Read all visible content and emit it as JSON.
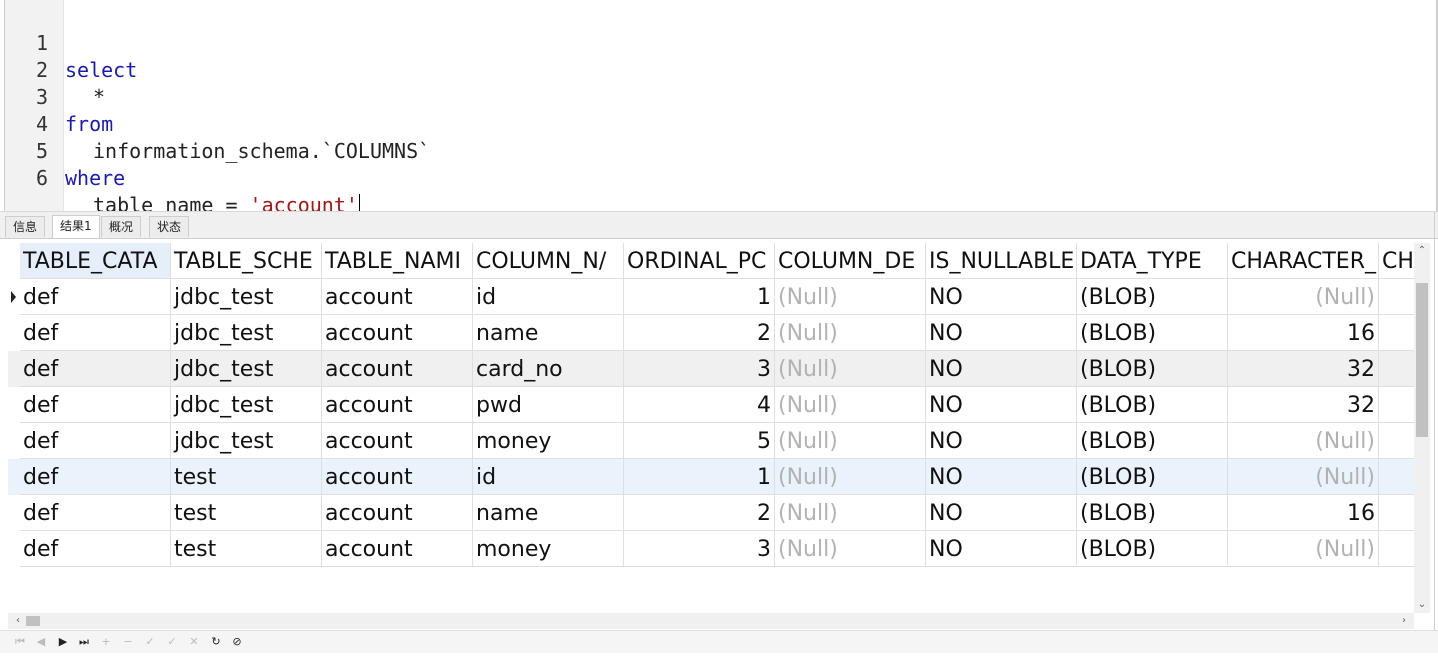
{
  "editor": {
    "lines": [
      {
        "num": "1",
        "text": "select"
      },
      {
        "num": "2",
        "text": "*"
      },
      {
        "num": "3",
        "text": "from"
      },
      {
        "num": "4",
        "text": "information_schema.`COLUMNS`"
      },
      {
        "num": "5",
        "text": "where"
      },
      {
        "num": "6",
        "prefix": "table_name = ",
        "string": "'account'"
      }
    ]
  },
  "tabs": [
    {
      "label": "信息"
    },
    {
      "label": "结果1"
    },
    {
      "label": "概况"
    },
    {
      "label": "状态"
    }
  ],
  "grid": {
    "columns": [
      "TABLE_CATA",
      "TABLE_SCHE",
      "TABLE_NAMI",
      "COLUMN_N/",
      "ORDINAL_PC",
      "COLUMN_DE",
      "IS_NULLABLE",
      "DATA_TYPE",
      "CHARACTER_",
      "CH"
    ],
    "rows": [
      [
        "def",
        "jdbc_test",
        "account",
        "id",
        "1",
        "(Null)",
        "NO",
        "(BLOB)",
        "(Null)"
      ],
      [
        "def",
        "jdbc_test",
        "account",
        "name",
        "2",
        "(Null)",
        "NO",
        "(BLOB)",
        "16"
      ],
      [
        "def",
        "jdbc_test",
        "account",
        "card_no",
        "3",
        "(Null)",
        "NO",
        "(BLOB)",
        "32"
      ],
      [
        "def",
        "jdbc_test",
        "account",
        "pwd",
        "4",
        "(Null)",
        "NO",
        "(BLOB)",
        "32"
      ],
      [
        "def",
        "jdbc_test",
        "account",
        "money",
        "5",
        "(Null)",
        "NO",
        "(BLOB)",
        "(Null)"
      ],
      [
        "def",
        "test",
        "account",
        "id",
        "1",
        "(Null)",
        "NO",
        "(BLOB)",
        "(Null)"
      ],
      [
        "def",
        "test",
        "account",
        "name",
        "2",
        "(Null)",
        "NO",
        "(BLOB)",
        "16"
      ],
      [
        "def",
        "test",
        "account",
        "money",
        "3",
        "(Null)",
        "NO",
        "(BLOB)",
        "(Null)"
      ]
    ]
  },
  "nav": {
    "buttons": [
      {
        "name": "first-record-icon",
        "glyph": "⏮",
        "enabled": false
      },
      {
        "name": "prev-record-icon",
        "glyph": "◀",
        "enabled": false
      },
      {
        "name": "next-record-icon",
        "glyph": "▶",
        "enabled": true
      },
      {
        "name": "last-record-icon",
        "glyph": "⏭",
        "enabled": true
      },
      {
        "name": "add-record-icon",
        "glyph": "+",
        "enabled": false
      },
      {
        "name": "delete-record-icon",
        "glyph": "−",
        "enabled": false
      },
      {
        "name": "apply-changes-icon",
        "glyph": "✓",
        "enabled": false
      },
      {
        "name": "discard-changes-icon",
        "glyph": "✓",
        "enabled": false
      },
      {
        "name": "cancel-changes-icon",
        "glyph": "✕",
        "enabled": false
      },
      {
        "name": "refresh-icon",
        "glyph": "↻",
        "enabled": true
      },
      {
        "name": "stop-icon",
        "glyph": "⊘",
        "enabled": true
      }
    ]
  },
  "colors": {
    "keyword": "#1919b8",
    "string": "#a31515",
    "null_text": "#b2b2b2",
    "selected_row": "#eaf2fb",
    "alt_row": "#f0f0f0"
  }
}
